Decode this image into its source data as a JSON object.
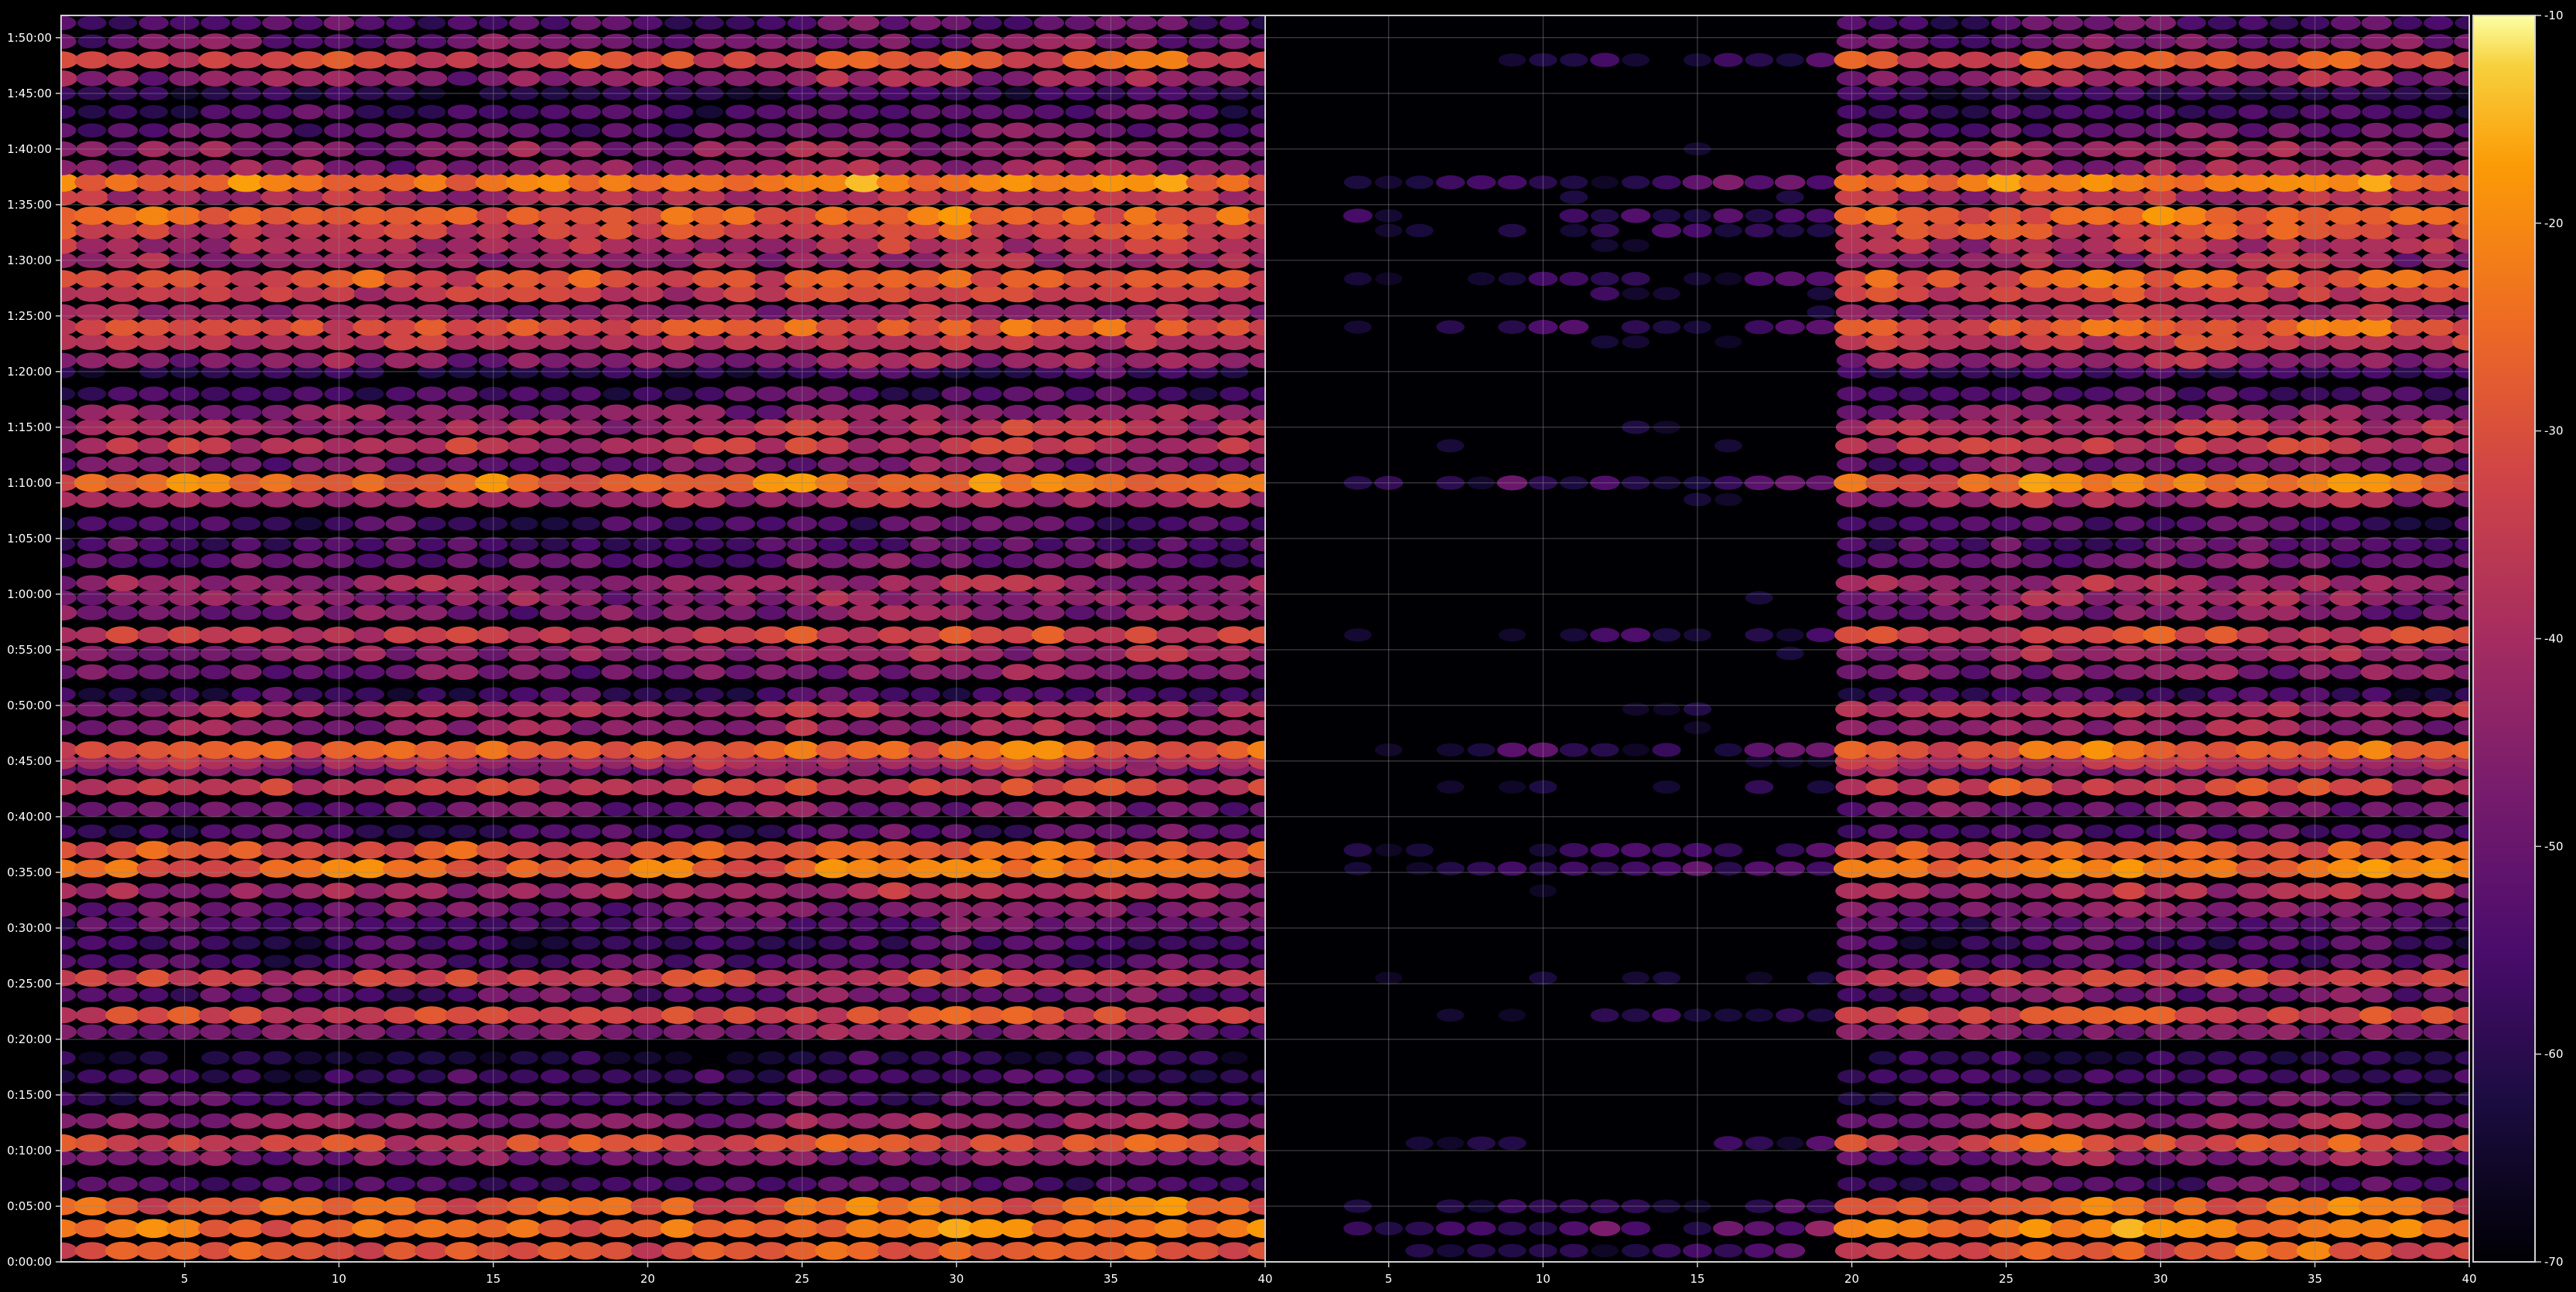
{
  "chart_data": {
    "type": "heatmap",
    "description_of_panels": "two side-by-side heatmap panels sharing a y axis (elapsed time) and a colorbar",
    "panels": [
      {
        "name": "",
        "x_range": [
          1,
          40
        ],
        "x_ticks": [
          5,
          10,
          15,
          20,
          25,
          30,
          35,
          40
        ],
        "onset": 1,
        "intensity_scale": 1.0
      },
      {
        "name": "",
        "x_range": [
          1,
          40
        ],
        "x_ticks": [
          5,
          10,
          15,
          20,
          25,
          30,
          35,
          40
        ],
        "onset": 20,
        "intensity_scale": 1.0
      }
    ],
    "y_range_seconds": [
      0,
      6720
    ],
    "y_ticks": [
      "0:00:00",
      "0:05:00",
      "0:10:00",
      "0:15:00",
      "0:20:00",
      "0:25:00",
      "0:30:00",
      "0:35:00",
      "0:40:00",
      "0:45:00",
      "0:50:00",
      "0:55:00",
      "1:00:00",
      "1:05:00",
      "1:10:00",
      "1:15:00",
      "1:20:00",
      "1:25:00",
      "1:30:00",
      "1:35:00",
      "1:40:00",
      "1:45:00",
      "1:50:00"
    ],
    "y_tick_seconds": [
      0,
      300,
      600,
      900,
      1200,
      1500,
      1800,
      2100,
      2400,
      2700,
      3000,
      3300,
      3600,
      3900,
      4200,
      4500,
      4800,
      5100,
      5400,
      5700,
      6000,
      6300,
      6600
    ],
    "colorbar": {
      "colormap": "inferno",
      "range": [
        -70,
        -10
      ],
      "ticks": [
        -10,
        -20,
        -30,
        -40,
        -50,
        -60,
        -70
      ]
    },
    "grid": true,
    "rows_seconds": [
      60,
      180,
      300,
      420,
      560,
      640,
      760,
      880,
      1000,
      1100,
      1240,
      1330,
      1440,
      1530,
      1620,
      1720,
      1820,
      1900,
      2000,
      2120,
      2220,
      2320,
      2440,
      2560,
      2660,
      2700,
      2760,
      2880,
      2980,
      3060,
      3180,
      3280,
      3380,
      3500,
      3580,
      3660,
      3780,
      3870,
      3980,
      4110,
      4200,
      4300,
      4400,
      4500,
      4580,
      4680,
      4800,
      4860,
      4960,
      5040,
      5120,
      5220,
      5300,
      5400,
      5480,
      5560,
      5640,
      5740,
      5820,
      5900,
      6000,
      6100,
      6200,
      6300,
      6380,
      6480,
      6580,
      6680
    ],
    "row_levels_dB": [
      -30,
      -25,
      -28,
      -55,
      -48,
      -33,
      -45,
      -55,
      -58,
      -62,
      -48,
      -33,
      -52,
      -35,
      -55,
      -58,
      -54,
      -48,
      -42,
      -25,
      -30,
      -55,
      -50,
      -35,
      -48,
      -40,
      -28,
      -45,
      -40,
      -58,
      -48,
      -45,
      -35,
      -48,
      -46,
      -44,
      -52,
      -55,
      -56,
      -42,
      -25,
      -50,
      -38,
      -40,
      -46,
      -56,
      -60,
      -45,
      -38,
      -30,
      -44,
      -36,
      -30,
      -44,
      -40,
      -34,
      -28,
      -40,
      -24,
      -46,
      -45,
      -52,
      -56,
      -60,
      -45,
      -32,
      -50,
      -55
    ]
  }
}
